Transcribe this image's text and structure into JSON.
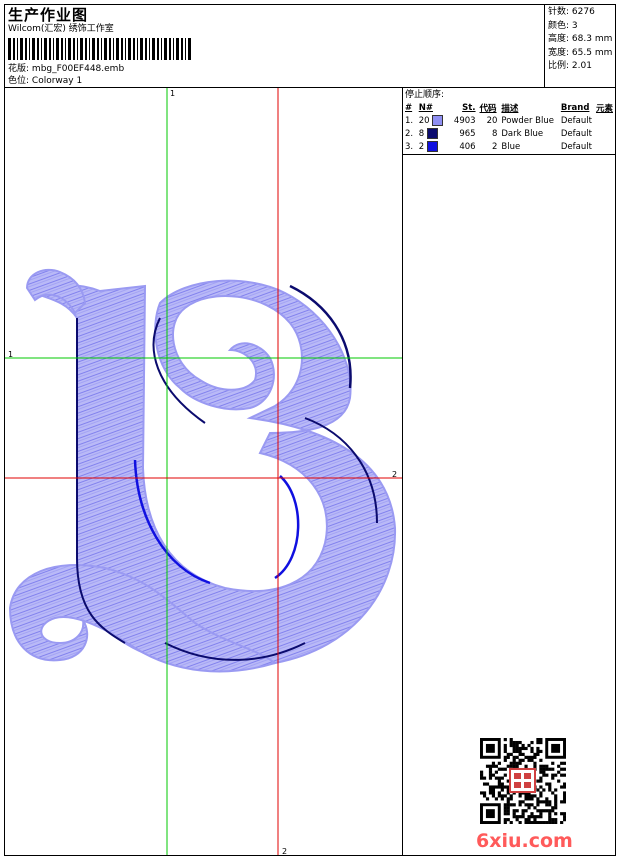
{
  "header": {
    "title": "生产作业图",
    "company": "Wilcom(汇宏) 绣饰工作室",
    "design_label": "花版:",
    "design_file": "mbg_F00EF448.emb",
    "colorway_label": "色位:",
    "colorway": "Colorway 1"
  },
  "stats": [
    {
      "label": "针数:",
      "value": "6276"
    },
    {
      "label": "颜色:",
      "value": "3"
    },
    {
      "label": "高度:",
      "value": "68.3 mm"
    },
    {
      "label": "宽度:",
      "value": "65.5 mm"
    },
    {
      "label": "比例:",
      "value": "2.01"
    }
  ],
  "stop_sequence": {
    "title": "停止顺序:",
    "headers": [
      "#",
      "N#",
      "St.",
      "代码",
      "描述",
      "Brand",
      "元素"
    ],
    "rows": [
      {
        "idx": "1.",
        "n": "20",
        "color": "#8f8ff2",
        "st": "4903",
        "code": "20",
        "desc": "Powder Blue",
        "brand": "Default"
      },
      {
        "idx": "2.",
        "n": "8",
        "color": "#0b0b6e",
        "st": "965",
        "code": "8",
        "desc": "Dark Blue",
        "brand": "Default"
      },
      {
        "idx": "3.",
        "n": "2",
        "color": "#1010e0",
        "st": "406",
        "code": "2",
        "desc": "Blue",
        "brand": "Default"
      }
    ]
  },
  "guides": {
    "green_v": "1",
    "green_h": "1",
    "red_h": "2",
    "red_v": "2"
  },
  "colors": {
    "powder_blue": "#8f8ff2",
    "dark_blue": "#0b0b6e",
    "blue": "#1010e0",
    "guide_green": "#00c800",
    "guide_red": "#e00000",
    "watermark": "#ff5a5a"
  },
  "watermark": "6xiu.com",
  "qr_icon": "qr-code-icon",
  "stamp_icon": "seal-stamp-icon"
}
